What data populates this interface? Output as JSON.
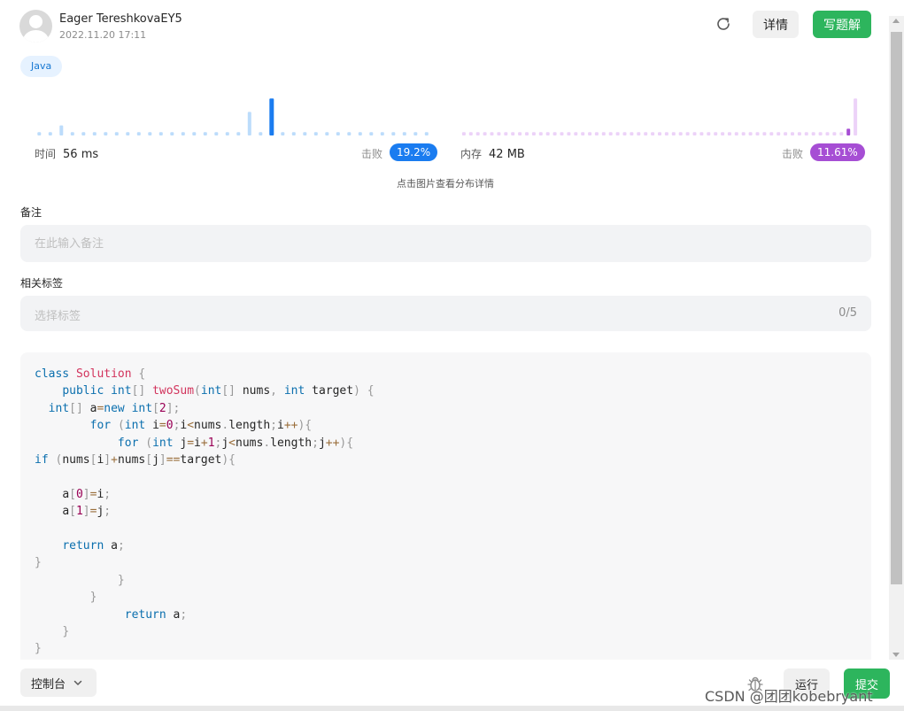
{
  "header": {
    "user_name": "Eager TereshkovaEY5",
    "timestamp": "2022.11.20 17:11",
    "detail_label": "详情",
    "write_solution_label": "写题解"
  },
  "language_tag": "Java",
  "runtime": {
    "label": "时间",
    "value": "56 ms",
    "beat_label": "击败",
    "beat_percent": "19.2%",
    "accent": "#1a7cf0"
  },
  "memory": {
    "label": "内存",
    "value": "42 MB",
    "beat_label": "击败",
    "beat_percent": "11.61%",
    "accent": "#a64ed4"
  },
  "chart_data": [
    {
      "type": "bar",
      "series": [
        {
          "values": [
            1,
            1,
            3,
            1,
            1,
            1,
            1,
            1,
            1,
            1,
            1,
            1,
            1,
            1,
            1,
            1,
            1,
            1,
            1,
            7,
            1,
            11,
            1,
            1,
            1,
            1,
            1,
            1,
            1,
            1,
            1,
            1,
            1,
            1,
            1,
            1
          ]
        }
      ],
      "highlight_index": 21
    },
    {
      "type": "bar",
      "series": [
        {
          "values": [
            1,
            1,
            1,
            1,
            1,
            1,
            1,
            1,
            1,
            1,
            1,
            1,
            1,
            1,
            1,
            1,
            1,
            1,
            1,
            1,
            1,
            1,
            1,
            1,
            1,
            1,
            1,
            1,
            1,
            1,
            1,
            1,
            1,
            1,
            1,
            1,
            1,
            1,
            1,
            1,
            1,
            1,
            1,
            1,
            1,
            1,
            1,
            1,
            1,
            1,
            1,
            1,
            1,
            1,
            1,
            2,
            11
          ]
        }
      ],
      "highlight_index": 55
    }
  ],
  "hint": "点击图片查看分布详情",
  "notes": {
    "label": "备注",
    "placeholder": "在此输入备注"
  },
  "tags": {
    "label": "相关标签",
    "placeholder": "选择标签",
    "count": "0/5"
  },
  "code_lines": [
    [
      {
        "t": "class ",
        "c": "kw"
      },
      {
        "t": "Solution",
        "c": "cls"
      },
      {
        "t": " {",
        "c": "pn"
      }
    ],
    [
      {
        "t": "    "
      },
      {
        "t": "public ",
        "c": "kw"
      },
      {
        "t": "int",
        "c": "kw"
      },
      {
        "t": "[] ",
        "c": "pn"
      },
      {
        "t": "twoSum",
        "c": "fn"
      },
      {
        "t": "(",
        "c": "pn"
      },
      {
        "t": "int",
        "c": "kw"
      },
      {
        "t": "[] ",
        "c": "pn"
      },
      {
        "t": "nums"
      },
      {
        "t": ", ",
        "c": "pn"
      },
      {
        "t": "int ",
        "c": "kw"
      },
      {
        "t": "target"
      },
      {
        "t": ") {",
        "c": "pn"
      }
    ],
    [
      {
        "t": "  "
      },
      {
        "t": "int",
        "c": "kw"
      },
      {
        "t": "[] ",
        "c": "pn"
      },
      {
        "t": "a"
      },
      {
        "t": "=",
        "c": "op"
      },
      {
        "t": "new ",
        "c": "kw"
      },
      {
        "t": "int",
        "c": "kw"
      },
      {
        "t": "[",
        "c": "pn"
      },
      {
        "t": "2",
        "c": "num"
      },
      {
        "t": "];",
        "c": "pn"
      }
    ],
    [
      {
        "t": "        "
      },
      {
        "t": "for ",
        "c": "kw"
      },
      {
        "t": "(",
        "c": "pn"
      },
      {
        "t": "int ",
        "c": "kw"
      },
      {
        "t": "i"
      },
      {
        "t": "=",
        "c": "op"
      },
      {
        "t": "0",
        "c": "num"
      },
      {
        "t": ";",
        "c": "pn"
      },
      {
        "t": "i"
      },
      {
        "t": "<",
        "c": "op"
      },
      {
        "t": "nums"
      },
      {
        "t": ".",
        "c": "pn"
      },
      {
        "t": "length"
      },
      {
        "t": ";",
        "c": "pn"
      },
      {
        "t": "i"
      },
      {
        "t": "++",
        "c": "op"
      },
      {
        "t": "){",
        "c": "pn"
      }
    ],
    [
      {
        "t": "            "
      },
      {
        "t": "for ",
        "c": "kw"
      },
      {
        "t": "(",
        "c": "pn"
      },
      {
        "t": "int ",
        "c": "kw"
      },
      {
        "t": "j"
      },
      {
        "t": "=",
        "c": "op"
      },
      {
        "t": "i"
      },
      {
        "t": "+",
        "c": "op"
      },
      {
        "t": "1",
        "c": "num"
      },
      {
        "t": ";",
        "c": "pn"
      },
      {
        "t": "j"
      },
      {
        "t": "<",
        "c": "op"
      },
      {
        "t": "nums"
      },
      {
        "t": ".",
        "c": "pn"
      },
      {
        "t": "length"
      },
      {
        "t": ";",
        "c": "pn"
      },
      {
        "t": "j"
      },
      {
        "t": "++",
        "c": "op"
      },
      {
        "t": "){",
        "c": "pn"
      }
    ],
    [
      {
        "t": "if ",
        "c": "kw"
      },
      {
        "t": "(",
        "c": "pn"
      },
      {
        "t": "nums"
      },
      {
        "t": "[",
        "c": "pn"
      },
      {
        "t": "i"
      },
      {
        "t": "]",
        "c": "pn"
      },
      {
        "t": "+",
        "c": "op"
      },
      {
        "t": "nums"
      },
      {
        "t": "[",
        "c": "pn"
      },
      {
        "t": "j"
      },
      {
        "t": "]",
        "c": "pn"
      },
      {
        "t": "==",
        "c": "op"
      },
      {
        "t": "target"
      },
      {
        "t": "){",
        "c": "pn"
      }
    ],
    [],
    [
      {
        "t": "    "
      },
      {
        "t": "a"
      },
      {
        "t": "[",
        "c": "pn"
      },
      {
        "t": "0",
        "c": "num"
      },
      {
        "t": "]",
        "c": "pn"
      },
      {
        "t": "=",
        "c": "op"
      },
      {
        "t": "i"
      },
      {
        "t": ";",
        "c": "pn"
      }
    ],
    [
      {
        "t": "    "
      },
      {
        "t": "a"
      },
      {
        "t": "[",
        "c": "pn"
      },
      {
        "t": "1",
        "c": "num"
      },
      {
        "t": "]",
        "c": "pn"
      },
      {
        "t": "=",
        "c": "op"
      },
      {
        "t": "j"
      },
      {
        "t": ";",
        "c": "pn"
      }
    ],
    [],
    [
      {
        "t": "    "
      },
      {
        "t": "return ",
        "c": "kw"
      },
      {
        "t": "a"
      },
      {
        "t": ";",
        "c": "pn"
      }
    ],
    [
      {
        "t": "}",
        "c": "pn"
      }
    ],
    [
      {
        "t": "            "
      },
      {
        "t": "}",
        "c": "pn"
      }
    ],
    [
      {
        "t": "        "
      },
      {
        "t": "}",
        "c": "pn"
      }
    ],
    [
      {
        "t": "             "
      },
      {
        "t": "return ",
        "c": "kw"
      },
      {
        "t": "a"
      },
      {
        "t": ";",
        "c": "pn"
      }
    ],
    [
      {
        "t": "    "
      },
      {
        "t": "}",
        "c": "pn"
      }
    ],
    [
      {
        "t": "}",
        "c": "pn"
      }
    ]
  ],
  "syntax_colors": {
    "kw": "#0b6fae",
    "cls": "#d2335c",
    "fn": "#d2335c",
    "num": "#990055",
    "op": "#9a6e3a",
    "pn": "#999999"
  },
  "footer": {
    "console_label": "控制台",
    "run_label": "运行",
    "submit_label": "提交",
    "watermark": "CSDN @团团kobebryant"
  },
  "colors": {
    "brand_green": "#2db55d",
    "runtime_bar": "#bcdcfb",
    "memory_bar": "#ecd2f8"
  }
}
